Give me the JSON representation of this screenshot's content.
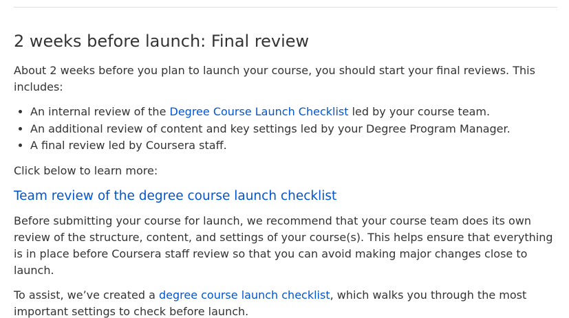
{
  "heading": "2 weeks before launch: Final review",
  "intro": "About 2 weeks before you plan to launch your course, you should start your final reviews. This includes:",
  "bullets": {
    "item1": {
      "before": "An internal review of the ",
      "link": "Degree Course Launch Checklist",
      "after": " led by your course team."
    },
    "item2": "An additional review of content and key settings led by your Degree Program Manager.",
    "item3": "A final review led by Coursera staff."
  },
  "click_below": "Click below to learn more:",
  "section_link": "Team review of the degree course launch checklist",
  "body_paragraph": "Before submitting your course for launch, we recommend that your course team does its own review of the structure, content, and settings of your course(s). This helps ensure that everything is in place before Coursera staff review so that you can avoid making major changes close to launch.",
  "assist": {
    "before": "To assist, we’ve created a ",
    "link": "degree course launch checklist",
    "after": ", which walks you through the most important settings to check before launch."
  }
}
